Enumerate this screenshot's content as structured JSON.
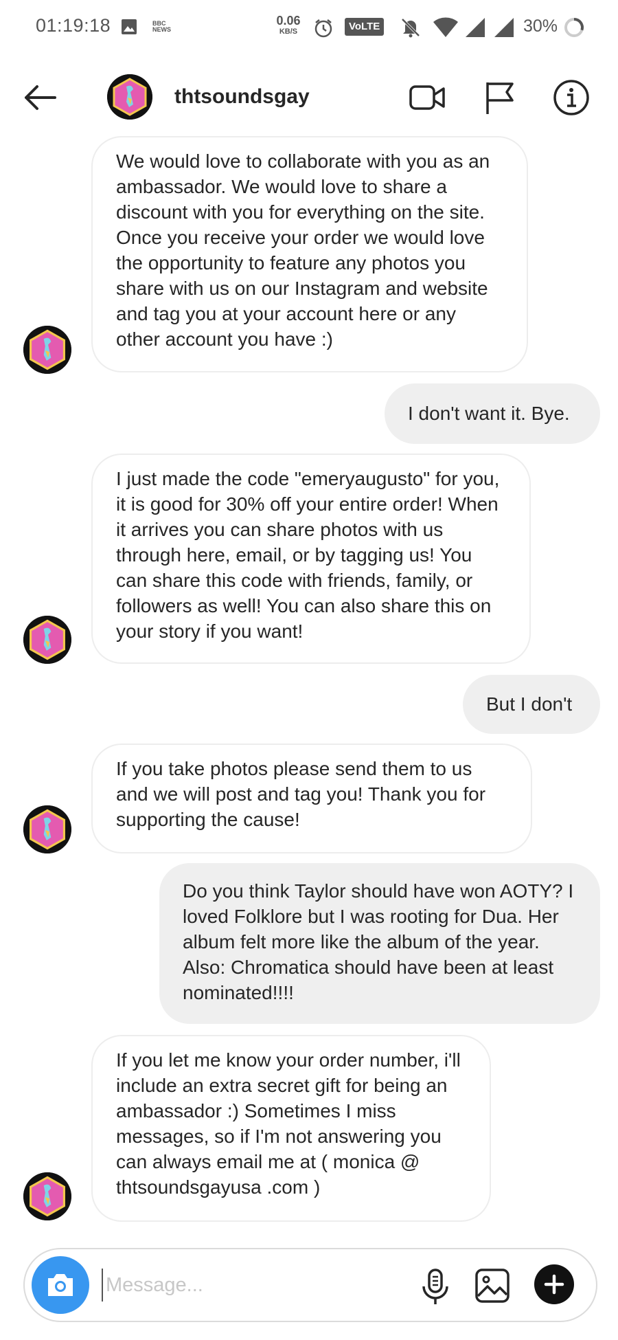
{
  "status_bar": {
    "time": "01:19:18",
    "bbc_label": "BBC NEWS",
    "net_speed_value": "0.06",
    "net_speed_unit": "KB/S",
    "volte_label": "VoLTE",
    "battery": "30%"
  },
  "header": {
    "username": "thtsoundsgay"
  },
  "messages": [
    {
      "direction": "incoming",
      "text": "We would love to collaborate with you as an ambassador. We would love to share a discount with you for everything on the site. Once you receive your order we would love the opportunity to feature any photos you share with us on our Instagram and website and tag you at your account here or any other account you have :)"
    },
    {
      "direction": "outgoing",
      "text": "I don't want it. Bye."
    },
    {
      "direction": "incoming",
      "text": "I just made the code \"emeryaugusto\" for you, it is good for 30% off your entire order! When it arrives you can share photos with us through here, email, or by tagging us! You can share this code with friends, family, or followers as well! You can also share this on your story if you want!"
    },
    {
      "direction": "outgoing",
      "text": "But I don't"
    },
    {
      "direction": "incoming",
      "text": "If you take photos please send them to us and we will post and tag you! Thank you for supporting the cause!"
    },
    {
      "direction": "outgoing",
      "text": "Do you think Taylor should have won AOTY? I loved Folklore but I was rooting for Dua. Her album felt more like the album of the year. Also: Chromatica should have been at least nominated!!!!"
    },
    {
      "direction": "incoming",
      "text": "If you let me know your order number, i'll include an extra secret gift for being an ambassador :) Sometimes I miss messages, so if I'm not answering you can always email me at ( monica @ thtsoundsgayusa .com )"
    }
  ],
  "composer": {
    "placeholder": "Message..."
  },
  "colors": {
    "accent": "#3897f0",
    "outgoing_bubble": "#efefef",
    "incoming_border": "#ededed",
    "avatar_pink": "#e45bb0"
  }
}
